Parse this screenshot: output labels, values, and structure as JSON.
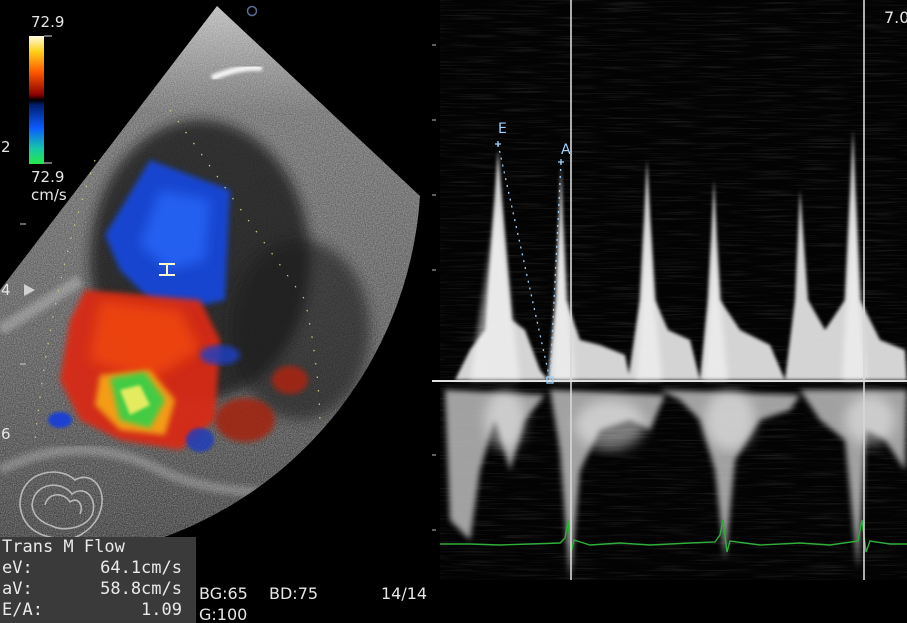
{
  "color_scale": {
    "max_label": "72.9",
    "min_label": "72.9",
    "unit_label": "cm/s"
  },
  "depth_marks": [
    {
      "label": "2"
    },
    {
      "label": "4"
    },
    {
      "label": "6"
    }
  ],
  "measurements": {
    "title": "Trans M Flow",
    "rows": [
      {
        "label": "eV:",
        "value": "64.1cm/s"
      },
      {
        "label": "aV:",
        "value": "58.8cm/s"
      },
      {
        "label": "E/A:",
        "value": "1.09"
      }
    ]
  },
  "settings": {
    "bg": "BG:65",
    "bd": "BD:75",
    "frame": "14/14",
    "g": "G:100"
  },
  "doppler": {
    "e_label": "E",
    "a_label": "A",
    "scale_label": "7.0"
  },
  "colors": {
    "ecg": "#2fae3a",
    "caliper": "#9fd2ff",
    "baseline": "#e0e0e0"
  }
}
